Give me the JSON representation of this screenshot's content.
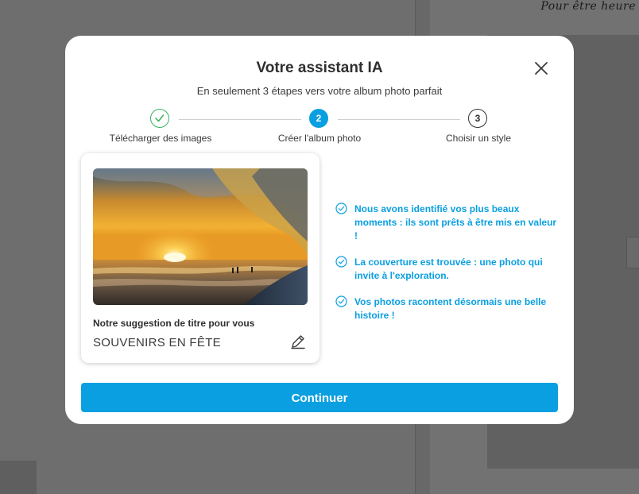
{
  "background": {
    "script_text": "Pour être heure"
  },
  "modal": {
    "title": "Votre assistant IA",
    "subtitle": "En seulement 3 étapes vers votre album photo parfait",
    "close_icon": "close-icon"
  },
  "stepper": {
    "steps": [
      {
        "number": "",
        "label": "Télécharger des images",
        "state": "done"
      },
      {
        "number": "2",
        "label": "Créer l'album photo",
        "state": "active"
      },
      {
        "number": "3",
        "label": "Choisir un style",
        "state": "upcoming"
      }
    ]
  },
  "card": {
    "label": "Notre suggestion de titre pour vous",
    "title": "SOUVENIRS EN FÊTE",
    "edit_icon": "pencil-icon"
  },
  "checklist": [
    "Nous avons identifié vos plus beaux moments : ils sont prêts à être mis en valeur !",
    "La couverture est trouvée : une photo qui invite à l'exploration.",
    "Vos photos racontent désormais une belle histoire !"
  ],
  "actions": {
    "continue_label": "Continuer"
  },
  "colors": {
    "accent": "#0a9fe0",
    "done": "#34b45d",
    "text": "#2f2f2f"
  }
}
